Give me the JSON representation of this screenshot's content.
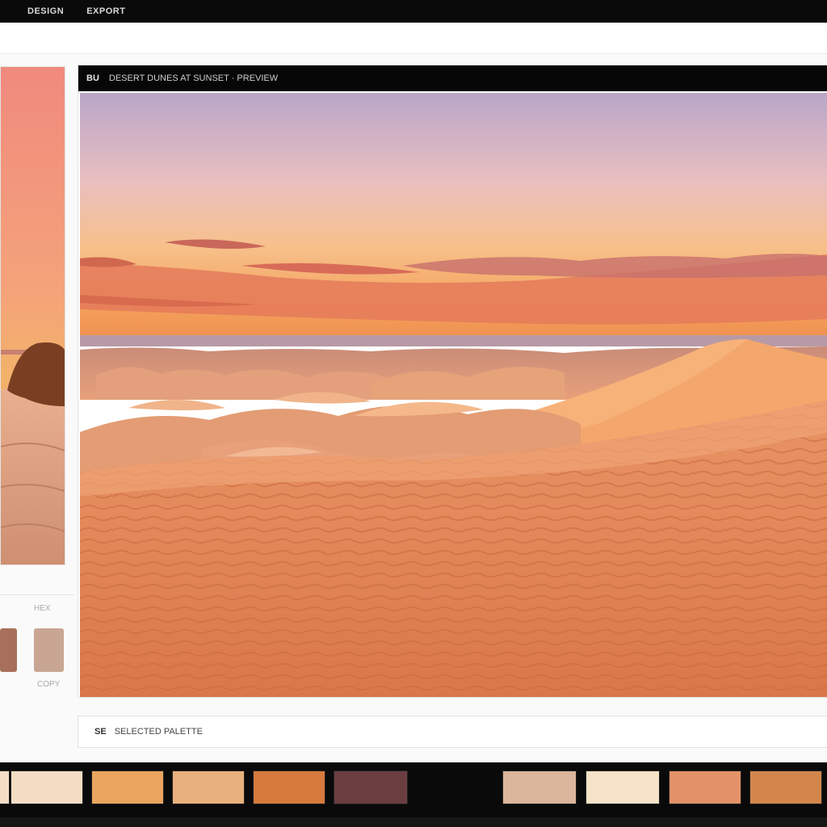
{
  "menu": {
    "items": [
      "DESIGN",
      "EXPORT"
    ]
  },
  "preview": {
    "header_icon": "BU",
    "header_title": "DESERT DUNES AT SUNSET · PREVIEW"
  },
  "status": {
    "icon": "SE",
    "text": "SELECTED PALETTE"
  },
  "left_panel": {
    "label_top": "HEX",
    "label_bottom": "COPY",
    "swatches": [
      "#a8705a",
      "#c9a694"
    ]
  },
  "palette": {
    "swatches": [
      "#f4ddc4",
      "#eaa45e",
      "#e8b07c",
      "#d67a3d",
      "#6b3e41",
      "#dbb69c",
      "#f6e3c8",
      "#e39267",
      "#d2864c"
    ]
  },
  "colors": {
    "sky_top": "#b8a6c8",
    "sky_horizon": "#f4a15b",
    "dune": "#e58a57"
  }
}
